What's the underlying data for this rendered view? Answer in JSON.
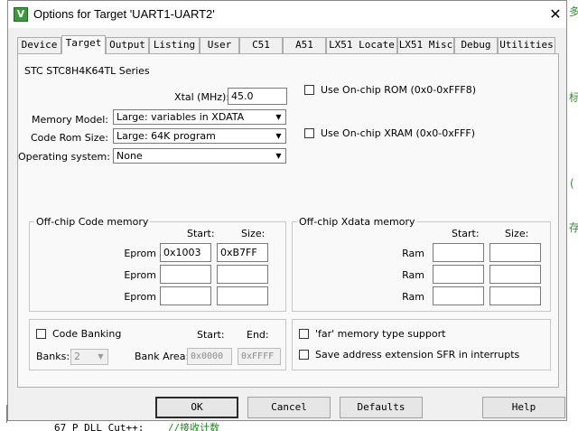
{
  "window": {
    "title": "Options for Target 'UART1-UART2'",
    "app_icon": "V",
    "close_glyph": "✕"
  },
  "tabs": [
    "Device",
    "Target",
    "Output",
    "Listing",
    "User",
    "C51",
    "A51",
    "LX51 Locate",
    "LX51 Misc",
    "Debug",
    "Utilities"
  ],
  "active_tab": "Target",
  "target": {
    "series": "STC STC8H4K64TL Series",
    "xtal": {
      "label": "Xtal (MHz):",
      "value": "45.0"
    },
    "memory_model": {
      "label": "Memory Model:",
      "value": "Large: variables in XDATA"
    },
    "code_rom_size": {
      "label": "Code Rom Size:",
      "value": "Large: 64K program"
    },
    "operating_system": {
      "label": "Operating system:",
      "value": "None"
    },
    "use_onchip_rom": {
      "label": "Use On-chip ROM (0x0-0xFFF8)",
      "checked": false
    },
    "use_onchip_xram": {
      "label": "Use On-chip XRAM (0x0-0xFFF)",
      "checked": false
    }
  },
  "offchip_code": {
    "title": "Off-chip Code memory",
    "start_header": "Start:",
    "size_header": "Size:",
    "rows": [
      {
        "label": "Eprom",
        "start": "0x1003",
        "size": "0xB7FF"
      },
      {
        "label": "Eprom",
        "start": "",
        "size": ""
      },
      {
        "label": "Eprom",
        "start": "",
        "size": ""
      }
    ]
  },
  "offchip_xdata": {
    "title": "Off-chip Xdata memory",
    "start_header": "Start:",
    "size_header": "Size:",
    "rows": [
      {
        "label": "Ram",
        "start": "",
        "size": ""
      },
      {
        "label": "Ram",
        "start": "",
        "size": ""
      },
      {
        "label": "Ram",
        "start": "",
        "size": ""
      }
    ]
  },
  "code_banking": {
    "label": "Code Banking",
    "checked": false,
    "start_header": "Start:",
    "end_header": "End:",
    "banks_label": "Banks:",
    "banks_value": "2",
    "bank_area_label": "Bank Area:",
    "bank_area_start": "0x0000",
    "bank_area_end": "0xFFFF"
  },
  "options": {
    "far_memory": {
      "label": "'far' memory type support",
      "checked": false
    },
    "save_sfr": {
      "label": "Save address extension SFR in interrupts",
      "checked": false
    }
  },
  "buttons": {
    "ok": "OK",
    "cancel": "Cancel",
    "defaults": "Defaults",
    "help": "Help"
  },
  "background": {
    "glyphs": [
      "多",
      "标",
      "(",
      "存"
    ],
    "code_line": {
      "code": "67    P_DLL_Cut++;",
      "comment": "//接收计数"
    }
  }
}
